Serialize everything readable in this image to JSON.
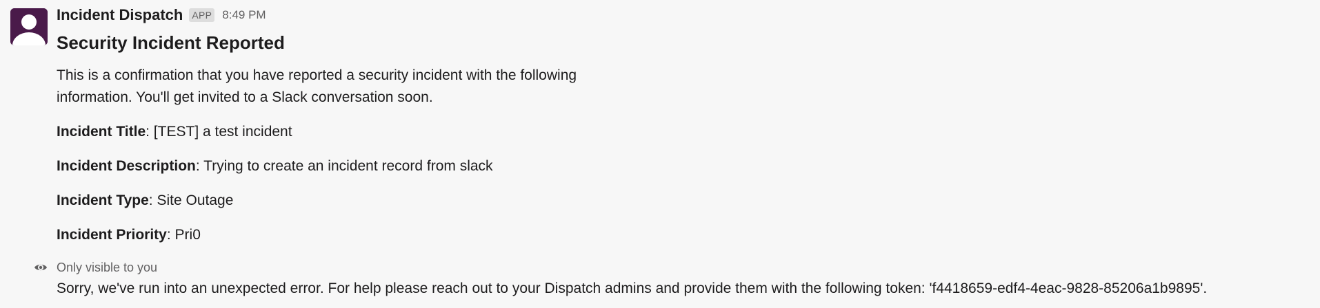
{
  "message": {
    "sender": "Incident Dispatch",
    "badge": "APP",
    "timestamp": "8:49 PM",
    "title": "Security Incident Reported",
    "intro_line1": "This is a confirmation that you have reported a security incident with the following",
    "intro_line2": "information. You'll get invited to a Slack conversation soon.",
    "fields": [
      {
        "label": "Incident Title",
        "value": ": [TEST] a test incident"
      },
      {
        "label": "Incident Description",
        "value": ": Trying to create an incident record from slack"
      },
      {
        "label": "Incident Type",
        "value": ": Site Outage"
      },
      {
        "label": "Incident Priority",
        "value": ": Pri0"
      }
    ],
    "visibility_note": "Only visible to you",
    "error_text": "Sorry, we've run into an unexpected error. For help please reach out to your Dispatch admins and provide them with the following token: 'f4418659-edf4-4eac-9828-85206a1b9895'."
  },
  "icons": {
    "avatar": "default-user-avatar-icon",
    "visibility": "eye-icon"
  },
  "colors": {
    "background": "#f7f7f7",
    "avatar_bg": "#4a1a4a",
    "text": "#1d1c1d",
    "muted": "#616061"
  }
}
